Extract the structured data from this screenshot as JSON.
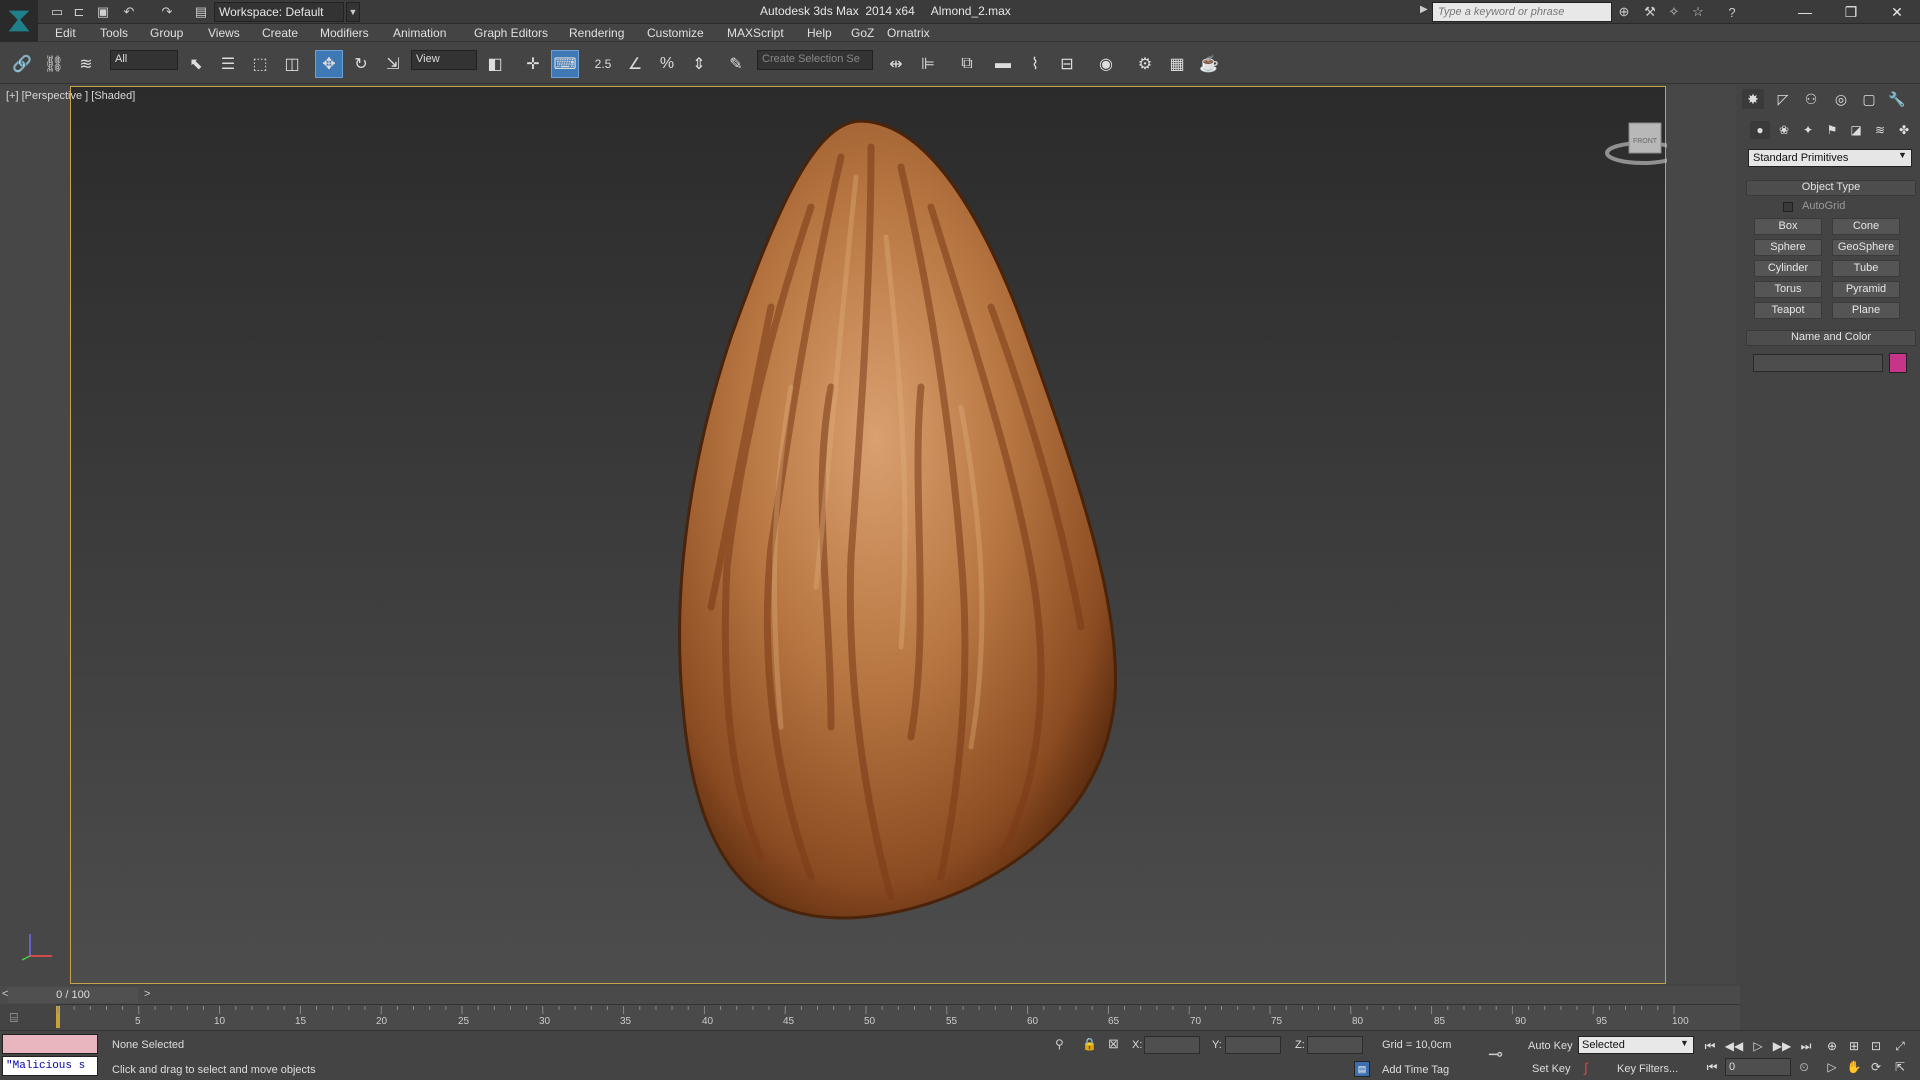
{
  "titlebar": {
    "workspace": "Workspace: Default",
    "window_title": "Autodesk 3ds Max  2014 x64     Almond_2.max",
    "search_placeholder": "Type a keyword or phrase"
  },
  "menu": [
    "Edit",
    "Tools",
    "Group",
    "Views",
    "Create",
    "Modifiers",
    "Animation",
    "Graph Editors",
    "Rendering",
    "Customize",
    "MAXScript",
    "Help",
    "GoZ",
    "Ornatrix"
  ],
  "toolbar": {
    "selection_filter": "All",
    "reference_coord": "View",
    "named_selection": "Create Selection Se",
    "snap_label": "2.5"
  },
  "viewport": {
    "label": "[+] [Perspective ] [Shaded]",
    "viewcube_face": "FRONT",
    "object_colors": {
      "almond_base": "#9c5a2c",
      "almond_highlight": "#d79e6a",
      "almond_stripe": "#7a3a16"
    },
    "border_color": "#c5a34a"
  },
  "command_panel": {
    "dropdown": "Standard Primitives",
    "object_type_title": "Object Type",
    "autogrid": "AutoGrid",
    "buttons": [
      "Box",
      "Cone",
      "Sphere",
      "GeoSphere",
      "Cylinder",
      "Tube",
      "Torus",
      "Pyramid",
      "Teapot",
      "Plane"
    ],
    "name_color_title": "Name and Color",
    "object_color": "#c8348a"
  },
  "timeline": {
    "frame_display": "0 / 100",
    "ticks": [
      "5",
      "10",
      "15",
      "20",
      "25",
      "30",
      "35",
      "40",
      "45",
      "50",
      "55",
      "60",
      "65",
      "70",
      "75",
      "80",
      "85",
      "90",
      "95",
      "100"
    ]
  },
  "status": {
    "listener_text": "\"Malicious s",
    "selection": "None Selected",
    "prompt": "Click and drag to select and move objects",
    "x_label": "X:",
    "y_label": "Y:",
    "z_label": "Z:",
    "grid": "Grid = 10,0cm",
    "add_time_tag": "Add Time Tag",
    "auto_key": "Auto Key",
    "set_key": "Set Key",
    "key_mode": "Selected",
    "key_filters": "Key Filters...",
    "current_frame": "0"
  }
}
